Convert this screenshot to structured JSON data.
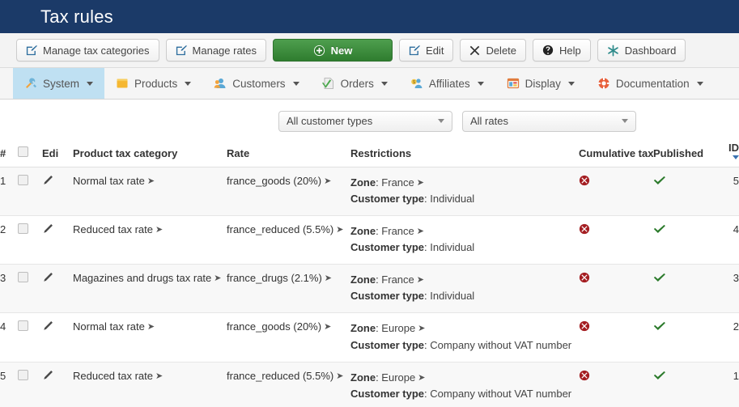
{
  "header": {
    "title": "Tax rules"
  },
  "toolbar": {
    "buttons": [
      {
        "label": "Manage tax categories",
        "icon": "edit-square-icon"
      },
      {
        "label": "Manage rates",
        "icon": "edit-square-icon"
      },
      {
        "label": "New",
        "icon": "plus-circle-icon"
      },
      {
        "label": "Edit",
        "icon": "edit-square-icon"
      },
      {
        "label": "Delete",
        "icon": "cross-icon"
      },
      {
        "label": "Help",
        "icon": "question-circle-icon"
      },
      {
        "label": "Dashboard",
        "icon": "asterisk-icon"
      }
    ]
  },
  "nav": {
    "items": [
      {
        "label": "System",
        "icon": "tools-icon",
        "active": true
      },
      {
        "label": "Products",
        "icon": "box-icon",
        "active": false
      },
      {
        "label": "Customers",
        "icon": "user-icon",
        "active": false
      },
      {
        "label": "Orders",
        "icon": "document-icon",
        "active": false
      },
      {
        "label": "Affiliates",
        "icon": "affiliate-icon",
        "active": false
      },
      {
        "label": "Display",
        "icon": "window-icon",
        "active": false
      },
      {
        "label": "Documentation",
        "icon": "lifebuoy-icon",
        "active": false
      }
    ]
  },
  "filters": [
    {
      "name": "customer-type-filter",
      "value": "All customer types"
    },
    {
      "name": "rate-filter",
      "value": "All rates"
    }
  ],
  "table": {
    "columns": {
      "num": "#",
      "edit": "Edi",
      "category": "Product tax category",
      "rate": "Rate",
      "restrictions": "Restrictions",
      "cumulative": "Cumulative tax",
      "published": "Published",
      "id": "ID"
    },
    "rows": [
      {
        "num": "1",
        "category": "Normal tax rate",
        "rate": "france_goods (20%)",
        "zone_label": "Zone",
        "zone_value": "France",
        "customer_label": "Customer type",
        "customer_value": "Individual",
        "cumulative": "no",
        "published": "yes",
        "id": "5"
      },
      {
        "num": "2",
        "category": "Reduced tax rate",
        "rate": "france_reduced (5.5%)",
        "zone_label": "Zone",
        "zone_value": "France",
        "customer_label": "Customer type",
        "customer_value": "Individual",
        "cumulative": "no",
        "published": "yes",
        "id": "4"
      },
      {
        "num": "3",
        "category": "Magazines and drugs tax rate",
        "rate": "france_drugs (2.1%)",
        "zone_label": "Zone",
        "zone_value": "France",
        "customer_label": "Customer type",
        "customer_value": "Individual",
        "cumulative": "no",
        "published": "yes",
        "id": "3"
      },
      {
        "num": "4",
        "category": "Normal tax rate",
        "rate": "france_goods (20%)",
        "zone_label": "Zone",
        "zone_value": "Europe",
        "customer_label": "Customer type",
        "customer_value": "Company without VAT number",
        "cumulative": "no",
        "published": "yes",
        "id": "2"
      },
      {
        "num": "5",
        "category": "Reduced tax rate",
        "rate": "france_reduced (5.5%)",
        "zone_label": "Zone",
        "zone_value": "Europe",
        "customer_label": "Customer type",
        "customer_value": "Company without VAT number",
        "cumulative": "no",
        "published": "yes",
        "id": "1"
      }
    ]
  },
  "colors": {
    "header_bg": "#1b3a68",
    "new_button_green": "#2f7d2f",
    "link_blue": "#3a72b0",
    "active_tab_blue": "#bfe0f2",
    "no_red": "#a41e22",
    "yes_green": "#2b7a2b"
  }
}
